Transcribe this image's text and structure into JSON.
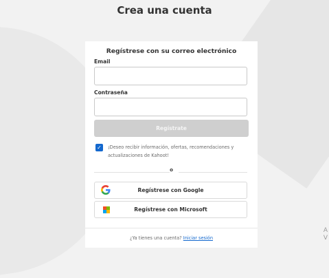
{
  "page": {
    "title": "Crea una cuenta"
  },
  "card": {
    "heading": "Regístrese con su correo electrónico",
    "email_label": "Email",
    "password_label": "Contraseña",
    "register_button": "Regístrate",
    "consent_text": "¡Deseo recibir información, ofertas, recomendaciones y actualizaciones de Kahoot!",
    "consent_checked": true,
    "divider_text": "o",
    "google_button": "Regístrese con Google",
    "microsoft_button": "Regístrese con Microsoft",
    "footer_prompt": "¿Ya tienes una cuenta?",
    "footer_link": "Iniciar sesión"
  },
  "edge": {
    "text": "A\nV"
  },
  "colors": {
    "accent": "#1368ce",
    "disabled_button": "#cfcfcf",
    "google_blue": "#4285F4",
    "google_red": "#EA4335",
    "google_yellow": "#FBBC05",
    "google_green": "#34A853",
    "ms_red": "#F25022",
    "ms_green": "#7FBA00",
    "ms_blue": "#00A4EF",
    "ms_yellow": "#FFB900"
  }
}
